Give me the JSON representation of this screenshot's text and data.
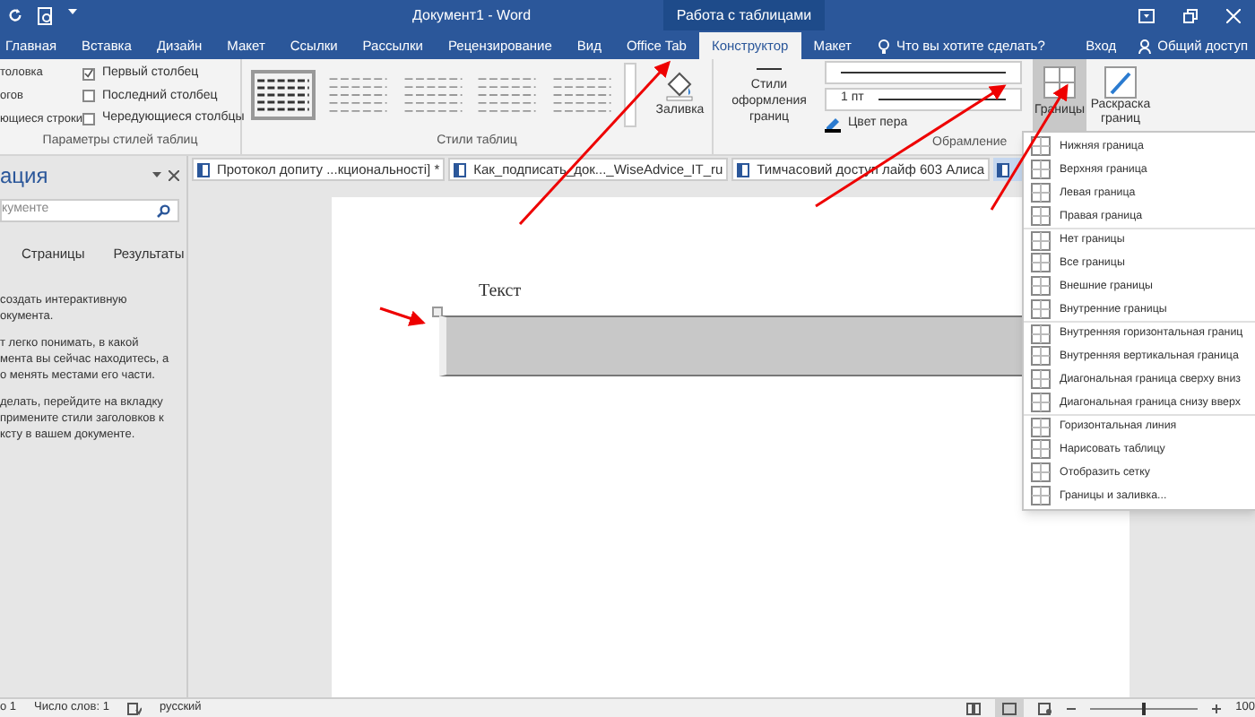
{
  "window": {
    "title": "Документ1 - Word",
    "context_title": "Работа с таблицами"
  },
  "tabs": [
    {
      "label": "Главная",
      "selected": false
    },
    {
      "label": "Вставка",
      "selected": false
    },
    {
      "label": "Дизайн",
      "selected": false
    },
    {
      "label": "Макет",
      "selected": false
    },
    {
      "label": "Ссылки",
      "selected": false
    },
    {
      "label": "Рассылки",
      "selected": false
    },
    {
      "label": "Рецензирование",
      "selected": false
    },
    {
      "label": "Вид",
      "selected": false
    },
    {
      "label": "Office Tab",
      "selected": false
    },
    {
      "label": "Конструктор",
      "selected": true
    },
    {
      "label": "Макет",
      "selected": false
    }
  ],
  "tell_me": "Что вы хотите сделать?",
  "sign_in": "Вход",
  "share": "Общий доступ",
  "style_options": {
    "label": "Параметры стилей таблиц",
    "left": [
      "толовка",
      "огов",
      "ющиеся строки"
    ],
    "right": [
      {
        "label": "Первый столбец",
        "checked": true
      },
      {
        "label": "Последний столбец",
        "checked": false
      },
      {
        "label": "Чередующиеся столбцы",
        "checked": false
      }
    ]
  },
  "table_styles": {
    "label": "Стили таблиц"
  },
  "shading": "Заливка",
  "border_styles": "Стили оформления границ",
  "pen_weight": "1 пт",
  "pen_color": "Цвет пера",
  "borders": "Границы",
  "border_painter": "Раскраска границ",
  "borders_group": "Обрамление",
  "nav_pane": {
    "title": "ация",
    "search_placeholder": "кументе",
    "tabs": [
      "Страницы",
      "Результаты"
    ],
    "paragraphs": [
      "создать интерактивную\nокумента.",
      "т легко понимать, в какой\nмента вы сейчас находитесь, а\nо менять местами его части.",
      "делать, перейдите на вкладку\nпримените стили заголовков к\nксту в вашем документе."
    ]
  },
  "doc_tabs": [
    "Протокол допиту ...кционaльності] *",
    "Как_подписать_док..._WiseAdvice_IT_ru",
    "Тимчасовий доступ лайф 603 Алиса"
  ],
  "document": {
    "text": "Текст"
  },
  "borders_menu": [
    "Нижняя граница",
    "Верхняя граница",
    "Левая граница",
    "Правая граница",
    "Нет границы",
    "Все границы",
    "Внешние границы",
    "Внутренние границы",
    "Внутренняя горизонтальная границ",
    "Внутренняя вертикальная граница",
    "Диагональная граница сверху вниз",
    "Диагональная граница снизу вверх",
    "Горизонтальная линия",
    "Нарисовать таблицу",
    "Отобразить сетку",
    "Границы и заливка..."
  ],
  "status_bar": {
    "page": "о 1",
    "words": "Число слов: 1",
    "language": "русский",
    "zoom": "100",
    "zoom_slider": {
      "level": 0.5
    }
  }
}
